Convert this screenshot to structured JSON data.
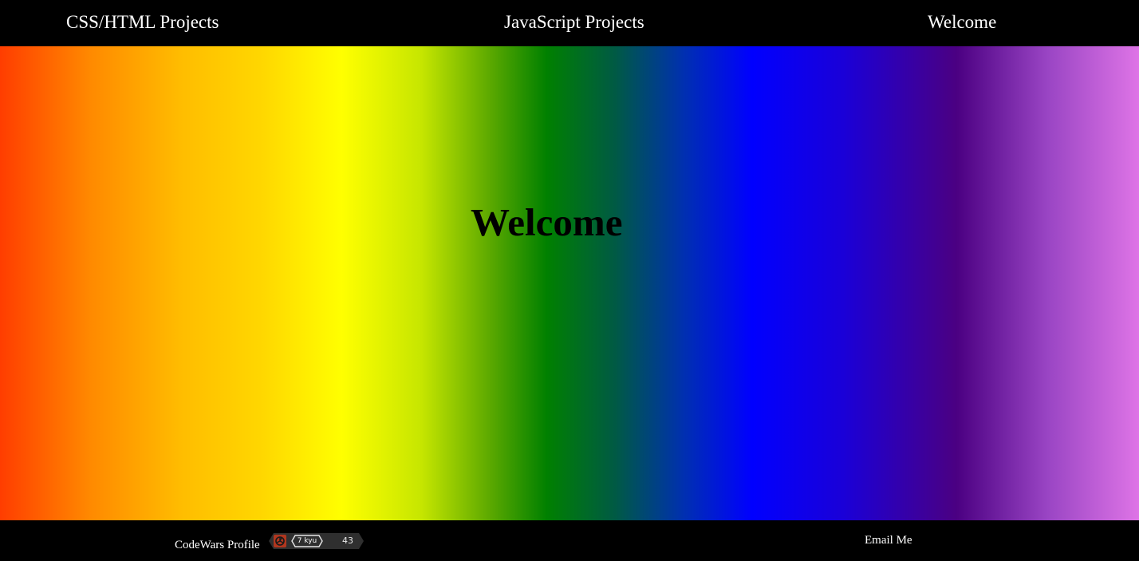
{
  "nav": {
    "items": [
      {
        "label": "CSS/HTML Projects"
      },
      {
        "label": "JavaScript Projects"
      },
      {
        "label": "Welcome"
      }
    ]
  },
  "hero": {
    "title": "Welcome",
    "gradient_colors": [
      "#ff3d00",
      "#ff8a00",
      "#ffd700",
      "#ffff00",
      "#008000",
      "#0000ff",
      "#4b0082",
      "#de74e6"
    ]
  },
  "footer": {
    "codewars_label": "CodeWars Profile",
    "badge": {
      "logo_icon": "codewars-logo-icon",
      "rank": "7 kyu",
      "honor": "43"
    },
    "email_label": "Email Me"
  },
  "colors": {
    "nav_background": "#000000",
    "nav_text": "#ffffff",
    "title_text": "#000000"
  }
}
